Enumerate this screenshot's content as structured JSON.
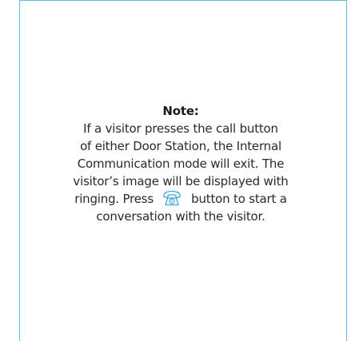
{
  "note": {
    "title": "Note:",
    "line1": "If a visitor presses the call button",
    "line2": "of either Door Station, the Internal",
    "line3": "Communication mode will exit. The",
    "line4": "visitor’s image will be displayed with",
    "line5_before": "ringing. Press",
    "line5_after": "button to start a",
    "line6": "conversation with the visitor."
  },
  "icons": {
    "talk_button": "phone-handset-icon"
  },
  "colors": {
    "frame": "#5bbfe0",
    "icon": "#3aa8d8",
    "text": "#2a2a2a"
  }
}
